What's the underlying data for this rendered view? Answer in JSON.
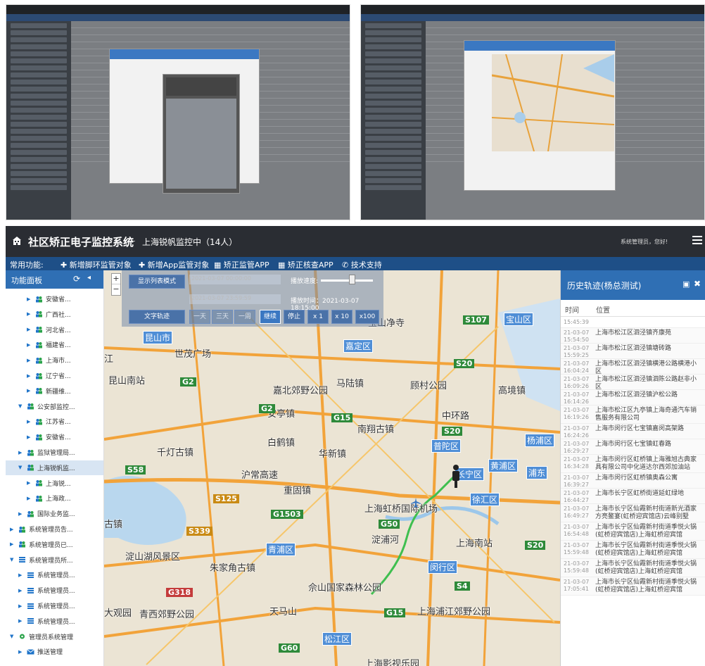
{
  "app": {
    "title": "社区矫正电子监控系统",
    "separator": "-",
    "subtitle": "上海锐帆监控中（14人）",
    "greeting": "系统管理员，您好!"
  },
  "menu": {
    "label": "常用功能:",
    "items": [
      "新增脚环监管对象",
      "新增App监管对象",
      "矫正监管APP",
      "矫正核查APP",
      "技术支持"
    ]
  },
  "sidebar": {
    "title": "功能面板",
    "nodes": [
      {
        "label": "安徽省..."
      },
      {
        "label": "广西社..."
      },
      {
        "label": "河北省..."
      },
      {
        "label": "福建省..."
      },
      {
        "label": "上海市..."
      },
      {
        "label": "辽宁省..."
      },
      {
        "label": "新疆维..."
      },
      {
        "label": "公安部监控..."
      },
      {
        "label": "江苏省..."
      },
      {
        "label": "安徽省..."
      },
      {
        "label": "监狱管理局..."
      },
      {
        "label": "上海锐帆监..."
      },
      {
        "label": "上海锐..."
      },
      {
        "label": "上海政..."
      },
      {
        "label": "国际业务监..."
      },
      {
        "label": "系统管理员告..."
      },
      {
        "label": "系统管理员已..."
      },
      {
        "label": "系统管理员所..."
      },
      {
        "label": "系统管理员..."
      },
      {
        "label": "系统管理员..."
      },
      {
        "label": "系统管理员..."
      },
      {
        "label": "系统管理员..."
      },
      {
        "label": "管理员系统管理"
      },
      {
        "label": "推送管理"
      }
    ]
  },
  "controls": {
    "list_mode": "显示列表模式",
    "text_track": "文字轨迹",
    "speed_label": "播放速度:",
    "play_time": "播放时间：2021-03-07 18:15:00",
    "date_start": "2021-03-07 00:00:00",
    "date_end": "2021-03-07 23:59:59",
    "range_day": "一天",
    "range_3day": "三天",
    "range_week": "一周",
    "continue": "继续",
    "stop": "停止",
    "x1": "x 1",
    "x10": "x 10",
    "x100": "x100",
    "speed_percent": 0.6
  },
  "map": {
    "places": [
      "宝山区",
      "宝山净寺",
      "昆山市",
      "世茂广场",
      "嘉定区",
      "昆山南站",
      "嘉北郊野公园",
      "马陆镇",
      "顾村公园",
      "高境镇",
      "安亭镇",
      "中环路",
      "南翔古镇",
      "白鹤镇",
      "华新镇",
      "千灯古镇",
      "普陀区",
      "杨浦区",
      "黄浦区",
      "浦东",
      "长宁区",
      "沪常高速",
      "重固镇",
      "上海虹桥国际机场",
      "徐汇区",
      "青浦区",
      "淀浦河",
      "上海南站",
      "闵行区",
      "淀山湖风景区",
      "朱家角古镇",
      "佘山国家森林公园",
      "大观园",
      "青西郊野公园",
      "天马山",
      "上海浦江郊野公园",
      "松江区",
      "上海影视乐园",
      "古镇",
      "江"
    ],
    "highways": [
      "S107",
      "S20",
      "G2",
      "G2",
      "G15",
      "S20",
      "S58",
      "S125",
      "G1503",
      "G50",
      "S20",
      "S4",
      "G318",
      "G15",
      "G60",
      "S339"
    ]
  },
  "history": {
    "title": "历史轨迹(杨总测试)",
    "col_time": "时间",
    "col_location": "位置",
    "first_time": "15:45:39",
    "rows": [
      {
        "date": "21-03-07",
        "time": "15:54:50",
        "location": "上海市松江区泗泾镇齐康苑"
      },
      {
        "date": "21-03-07",
        "time": "15:59:25",
        "location": "上海市松江区泗泾镇塘砖路"
      },
      {
        "date": "21-03-07",
        "time": "16:04:24",
        "location": "上海市松江区泗泾镇横港公路横港小区"
      },
      {
        "date": "21-03-07",
        "time": "16:09:26",
        "location": "上海市松江区泗泾镇泗陈公路赵非小区"
      },
      {
        "date": "21-03-07",
        "time": "16:14:26",
        "location": "上海市松江区泗泾镇沪松公路"
      },
      {
        "date": "21-03-07",
        "time": "16:19:26",
        "location": "上海市松江区九亭镇上海奇通汽车销售服务有限公司"
      },
      {
        "date": "21-03-07",
        "time": "16:24:26",
        "location": "上海市闵行区七宝镇嘉闵高架路"
      },
      {
        "date": "21-03-07",
        "time": "16:29:27",
        "location": "上海市闵行区七宝镇虹春路"
      },
      {
        "date": "21-03-07",
        "time": "16:34:28",
        "location": "上海市闵行区虹桥镇上海雅旭古典家具有限公司中化道达尔西郊加油站"
      },
      {
        "date": "21-03-07",
        "time": "16:39:27",
        "location": "上海市闵行区虹桥镇奥森公寓"
      },
      {
        "date": "21-03-07",
        "time": "16:44:27",
        "location": "上海市长宁区虹桥街道延虹绿地"
      },
      {
        "date": "21-03-07",
        "time": "16:49:27",
        "location": "上海市长宁区仙霞新村街道新光酒家方亮鳌宴(虹桥迎宾馆店)云峰别墅"
      },
      {
        "date": "21-03-07",
        "time": "16:54:48",
        "location": "上海市长宁区仙霞新村街道季悦火锅(虹桥迎宾馆店)上海虹桥迎宾馆"
      },
      {
        "date": "21-03-07",
        "time": "15:59:48",
        "location": "上海市长宁区仙霞新村街道季悦火锅(虹桥迎宾馆店)上海虹桥迎宾馆"
      },
      {
        "date": "21-03-07",
        "time": "15:59:48",
        "location": "上海市长宁区仙霞新村街道季悦火锅(虹桥迎宾馆店)上海虹桥迎宾馆"
      },
      {
        "date": "21-03-07",
        "time": "17:05:41",
        "location": "上海市长宁区仙霞新村街道季悦火锅(虹桥迎宾馆店)上海虹桥迎宾馆"
      }
    ]
  },
  "colors": {
    "topbar": "#2a2d33",
    "menubar": "#1e4f87",
    "panel_head": "#2f6fb4",
    "track": "#3fbf4f"
  }
}
